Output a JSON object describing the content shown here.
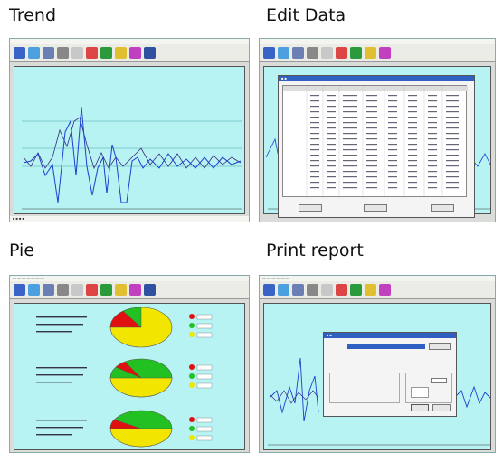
{
  "captions": {
    "trend": "Trend",
    "edit": "Edit Data",
    "pie": "Pie",
    "print": "Print report"
  },
  "toolbar_icons": [
    "chart-icon",
    "arrow-icon",
    "save-icon",
    "print-icon",
    "edit-icon",
    "bar-icon",
    "pie-icon",
    "settings-icon",
    "help-icon",
    "exit-icon"
  ],
  "colors": {
    "plot_bg": "#b7f3f3",
    "frame": "#d9dcd8",
    "line_sys": "#1d3fcf",
    "line_dia": "#222222",
    "pie_yellow": "#f2e600",
    "pie_red": "#e01010",
    "pie_green": "#22c020"
  }
}
